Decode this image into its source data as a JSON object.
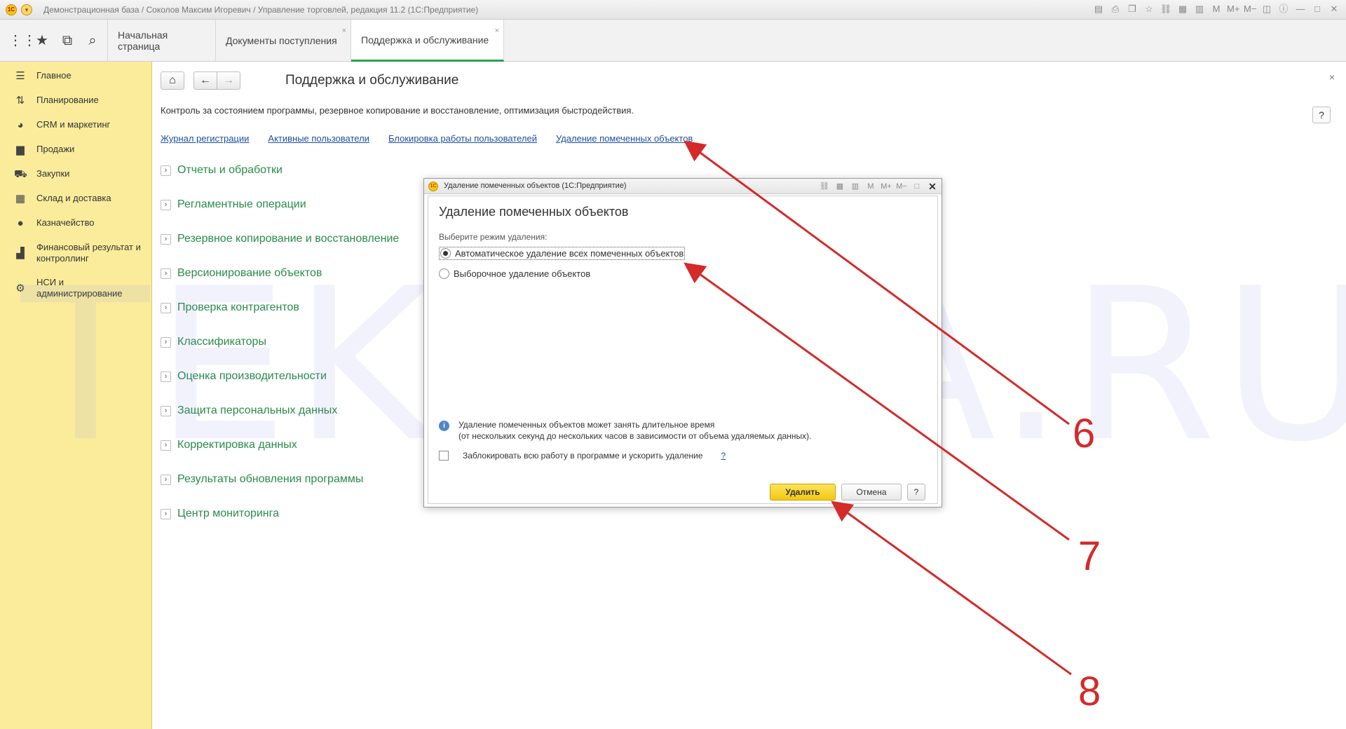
{
  "titlebar": {
    "title": "Демонстрационная база / Соколов Максим Игоревич / Управление торговлей, редакция 11.2  (1С:Предприятие)",
    "logo": "1С"
  },
  "tabs": [
    {
      "label": "Начальная страница"
    },
    {
      "label": "Документы поступления"
    },
    {
      "label": "Поддержка и обслуживание"
    }
  ],
  "sidebar": {
    "items": [
      {
        "label": "Главное",
        "icon": "menu-lines-icon"
      },
      {
        "label": "Планирование",
        "icon": "planning-icon"
      },
      {
        "label": "CRM и маркетинг",
        "icon": "pie-chart-icon"
      },
      {
        "label": "Продажи",
        "icon": "shopping-bag-icon"
      },
      {
        "label": "Закупки",
        "icon": "cart-icon"
      },
      {
        "label": "Склад и доставка",
        "icon": "warehouse-grid-icon"
      },
      {
        "label": "Казначейство",
        "icon": "coin-icon"
      },
      {
        "label": "Финансовый результат и контроллинг",
        "icon": "bar-chart-icon"
      },
      {
        "label": "НСИ и администрирование",
        "icon": "gear-icon"
      }
    ]
  },
  "main": {
    "title": "Поддержка и обслуживание",
    "description": "Контроль за состоянием программы, резервное копирование и восстановление, оптимизация быстродействия.",
    "help": "?",
    "close": "×",
    "links": [
      "Журнал регистрации",
      "Активные пользователи",
      "Блокировка работы пользователей",
      "Удаление помеченных объектов"
    ],
    "sections": [
      "Отчеты и обработки",
      "Регламентные операции",
      "Резервное копирование и восстановление",
      "Версионирование объектов",
      "Проверка контрагентов",
      "Классификаторы",
      "Оценка производительности",
      "Защита персональных данных",
      "Корректировка данных",
      "Результаты обновления программы",
      "Центр мониторинга"
    ]
  },
  "dialog": {
    "window_title": "Удаление помеченных объектов  (1С:Предприятие)",
    "heading": "Удаление помеченных объектов",
    "mode_label": "Выберите режим удаления:",
    "option_auto": "Автоматическое удаление всех помеченных объектов",
    "option_selective": "Выборочное удаление объектов",
    "selected_option": "auto",
    "info_line1": "Удаление помеченных объектов может занять длительное время",
    "info_line2": "(от нескольких секунд до нескольких часов в зависимости от объема удаляемых данных).",
    "lock_checkbox": "Заблокировать всю работу в программе и ускорить удаление",
    "lock_checked": false,
    "lock_help": "?",
    "delete_button": "Удалить",
    "cancel_button": "Отмена",
    "help_button": "?"
  },
  "watermark": "TEKDATA.RU",
  "annotations": [
    "6",
    "7",
    "8"
  ],
  "colors": {
    "sidebar_bg": "#fbec9c",
    "section_link": "#2a8a4b",
    "hyperlink": "#1c4f9c",
    "active_tab_underline": "#2e9e55",
    "primary_button": "#f2c811",
    "annotation_red": "#d42a2a"
  }
}
